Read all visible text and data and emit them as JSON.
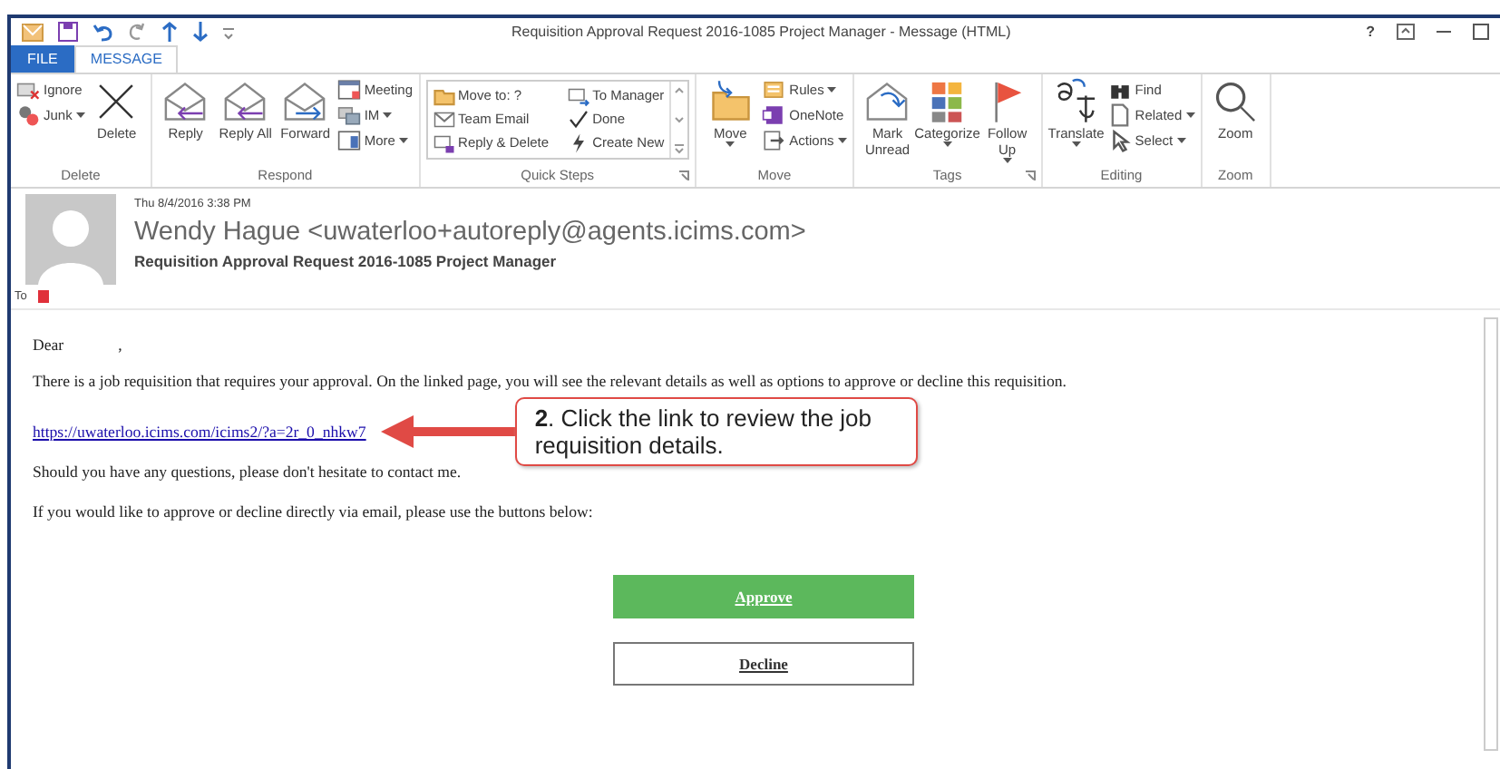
{
  "window": {
    "title": "Requisition Approval Request 2016-1085 Project Manager - Message (HTML)",
    "help": "?"
  },
  "tabs": [
    {
      "label": "FILE",
      "selected": false,
      "kind": "file"
    },
    {
      "label": "MESSAGE",
      "selected": true,
      "kind": "tab"
    }
  ],
  "ribbon": {
    "groups": [
      {
        "label": "Delete",
        "columns": [
          {
            "kind": "stack",
            "items": [
              {
                "label": "Ignore",
                "dropdown": false
              },
              {
                "label": "Junk",
                "dropdown": true
              }
            ]
          },
          {
            "kind": "large",
            "items": [
              {
                "label": "Delete",
                "dropdown": false
              }
            ]
          }
        ]
      },
      {
        "label": "Respond",
        "columns": [
          {
            "kind": "large",
            "items": [
              {
                "label": "Reply",
                "dropdown": false
              }
            ]
          },
          {
            "kind": "large",
            "items": [
              {
                "label": "Reply All",
                "dropdown": false
              }
            ]
          },
          {
            "kind": "large",
            "items": [
              {
                "label": "Forward",
                "dropdown": false
              }
            ]
          },
          {
            "kind": "stack",
            "items": [
              {
                "label": "Meeting",
                "dropdown": false
              },
              {
                "label": "IM",
                "dropdown": true
              },
              {
                "label": "More",
                "dropdown": true
              }
            ]
          }
        ]
      },
      {
        "label": "Quick Steps",
        "launcher": true,
        "columns": [
          {
            "kind": "gallery",
            "items": [
              {
                "label": "Move to: ?",
                "dropdown": false
              },
              {
                "label": "Team Email",
                "dropdown": false
              },
              {
                "label": "Reply & Delete",
                "dropdown": false
              },
              {
                "label": "To Manager",
                "dropdown": false
              },
              {
                "label": "Done",
                "dropdown": false
              },
              {
                "label": "Create New",
                "dropdown": false
              }
            ]
          }
        ]
      },
      {
        "label": "Move",
        "columns": [
          {
            "kind": "large",
            "items": [
              {
                "label": "Move",
                "dropdown": true
              }
            ]
          },
          {
            "kind": "stack",
            "items": [
              {
                "label": "Rules",
                "dropdown": true
              },
              {
                "label": "OneNote",
                "dropdown": false
              },
              {
                "label": "Actions",
                "dropdown": true
              }
            ]
          }
        ]
      },
      {
        "label": "Tags",
        "launcher": true,
        "columns": [
          {
            "kind": "large",
            "items": [
              {
                "label": "Mark Unread",
                "dropdown": false
              }
            ]
          },
          {
            "kind": "large",
            "items": [
              {
                "label": "Categorize",
                "dropdown": true
              }
            ]
          },
          {
            "kind": "large",
            "items": [
              {
                "label": "Follow Up",
                "dropdown": true
              }
            ]
          }
        ]
      },
      {
        "label": "Editing",
        "columns": [
          {
            "kind": "large",
            "items": [
              {
                "label": "Translate",
                "dropdown": true
              }
            ]
          },
          {
            "kind": "stack",
            "items": [
              {
                "label": "Find",
                "dropdown": false
              },
              {
                "label": "Related",
                "dropdown": true
              },
              {
                "label": "Select",
                "dropdown": true
              }
            ]
          }
        ]
      },
      {
        "label": "Zoom",
        "columns": [
          {
            "kind": "large",
            "items": [
              {
                "label": "Zoom",
                "dropdown": false
              }
            ]
          }
        ]
      }
    ]
  },
  "header": {
    "date": "Thu 8/4/2016 3:38 PM",
    "sender": "Wendy Hague <uwaterloo+autoreply@agents.icims.com>",
    "subject": "Requisition Approval Request 2016-1085 Project Manager",
    "to_label": "To"
  },
  "body": {
    "greeting": "Dear",
    "greeting_end": ",",
    "paragraphs": [
      {
        "kind": "text",
        "text": "There is a job requisition that requires your approval. On the linked page, you will see the relevant details as well as options to approve or decline this requisition."
      },
      {
        "kind": "link",
        "text": "https://uwaterloo.icims.com/icims2/?a=2r_0_nhkw7"
      },
      {
        "kind": "text",
        "text": "Should you have any questions, please don't hesitate to contact me."
      },
      {
        "kind": "text",
        "text": "If you would like to approve or decline directly via email, please use the buttons below:"
      }
    ],
    "buttons": [
      {
        "label": "Approve",
        "kind": "primary"
      },
      {
        "label": "Decline",
        "kind": "secondary"
      }
    ]
  },
  "callout": {
    "text": "**2**. Click the link to review the job requisition details."
  }
}
